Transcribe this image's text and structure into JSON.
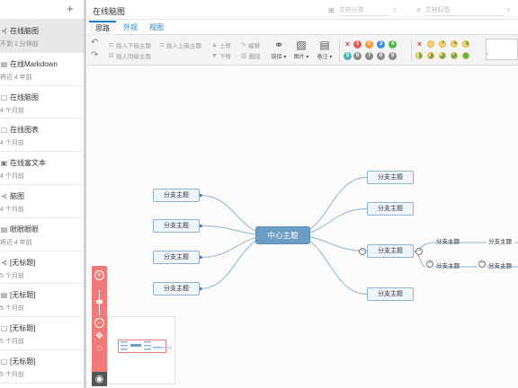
{
  "sidebar": {
    "add_label": "+",
    "notes": [
      {
        "icon": "mindmap-icon",
        "glyph": "⊰",
        "title": "在线脑图",
        "date": "不到 1 分钟前",
        "active": true
      },
      {
        "icon": "markdown-icon",
        "glyph": "▤",
        "title": "在线Markdown",
        "date": "将近 4 年前",
        "active": false
      },
      {
        "icon": "doc-icon",
        "glyph": "▢",
        "title": "在线脑图",
        "date": "4 个月前",
        "active": false
      },
      {
        "icon": "doc-icon",
        "glyph": "▢",
        "title": "在线图表",
        "date": "4 个月前",
        "active": false
      },
      {
        "icon": "richtext-icon",
        "glyph": "▣",
        "title": "在线富文本",
        "date": "4 个月前",
        "active": false
      },
      {
        "icon": "mindmap-icon",
        "glyph": "⊰",
        "title": "脑图",
        "date": "4 个月前",
        "active": false
      },
      {
        "icon": "markdown-icon",
        "glyph": "▤",
        "title": "眼眼眼眼",
        "date": "将近 4 年前",
        "active": false
      },
      {
        "icon": "mindmap-icon",
        "glyph": "⊰",
        "title": "[无标题]",
        "date": "5 个月前",
        "active": false
      },
      {
        "icon": "markdown-icon",
        "glyph": "▤",
        "title": "[无标题]",
        "date": "5 个月前",
        "active": false
      },
      {
        "icon": "doc-icon",
        "glyph": "▢",
        "title": "[无标题]",
        "date": "5 个月前",
        "active": false
      },
      {
        "icon": "doc-icon",
        "glyph": "▢",
        "title": "[无标题]",
        "date": "5 个月前",
        "active": false
      }
    ]
  },
  "header": {
    "title": "在线脑图",
    "category_placeholder": "文档分类",
    "category_icon": "grid-icon",
    "tag_placeholder": "文档标签",
    "tag_icon": "tag-icon"
  },
  "tabs": [
    {
      "label": "思路",
      "active": true
    },
    {
      "label": "外观",
      "active": false
    },
    {
      "label": "视图",
      "active": false
    }
  ],
  "toolbar": {
    "insert_child": "插入下级主题",
    "insert_parent": "插入上级主题",
    "insert_sibling": "插入同级主题",
    "move_up": "上移",
    "move_down": "下移",
    "edit": "编辑",
    "delete": "删除",
    "link": "链接",
    "image": "图片",
    "note": "备注",
    "priorities": [
      "1",
      "2",
      "3",
      "4",
      "5",
      "6",
      "7",
      "8",
      "9"
    ],
    "priority_colors": [
      "#e45a5a",
      "#f39a3c",
      "#3f8fd8",
      "#55b34b",
      "#4fb3b3",
      "#8a8a8a",
      "#8a8a8a",
      "#8a8a8a",
      "#8a8a8a"
    ]
  },
  "mindmap": {
    "root": "中心主题",
    "left_branches": [
      "分支主题",
      "分支主题",
      "分支主题",
      "分支主题"
    ],
    "right_branches": [
      "分支主题",
      "分支主题",
      "分支主题",
      "分支主题"
    ],
    "sub_topics": [
      "分支主题",
      "分支主题",
      "分支主题",
      "分支主题"
    ],
    "accent_color": "#f07a7a",
    "node_border": "#8fb3d3",
    "root_color": "#6b9ec4"
  },
  "zoom": {
    "in_label": "+",
    "out_label": "−",
    "level": 0.55
  }
}
